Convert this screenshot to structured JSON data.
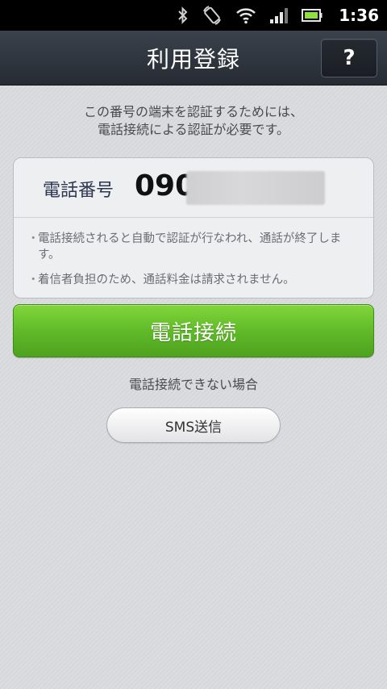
{
  "status_bar": {
    "time": "1:36",
    "icons": [
      "bluetooth-icon",
      "rotation-lock-icon",
      "wifi-icon",
      "signal-icon",
      "battery-icon"
    ],
    "battery_color": "#8ee03a"
  },
  "header": {
    "title": "利用登録",
    "help_label": "?"
  },
  "main": {
    "description_line1": "この番号の端末を認証するためには、",
    "description_line2": "電話接続による認証が必要です。",
    "phone_label": "電話番号",
    "phone_value": "090",
    "notes": [
      "電話接続されると自動で認証が行なわれ、通話が終了します。",
      "着信者負担のため、通話料金は請求されません。"
    ],
    "bullet": "・",
    "call_button_label": "電話接続",
    "cannot_connect_text": "電話接続できない場合",
    "sms_button_label": "SMS送信"
  },
  "colors": {
    "accent_green": "#5eb827",
    "header_bg": "#2e343c"
  }
}
